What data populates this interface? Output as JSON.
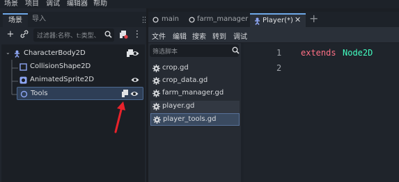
{
  "menu": [
    "场景",
    "项目",
    "调试",
    "编辑器",
    "帮助"
  ],
  "left_dock": {
    "tabs": [
      {
        "label": "场景",
        "active": true
      },
      {
        "label": "导入",
        "active": false
      }
    ],
    "filter_placeholder": "过滤器:名称、t:类型、",
    "tree": [
      {
        "label": "CharacterBody2D",
        "icon": "character-body-icon",
        "script": true,
        "visible": true
      },
      {
        "label": "CollisionShape2D",
        "icon": "collision-shape-icon",
        "script": false,
        "visible": false
      },
      {
        "label": "AnimatedSprite2D",
        "icon": "animated-sprite-icon",
        "script": false,
        "visible": true
      },
      {
        "label": "Tools",
        "icon": "node2d-icon",
        "script": true,
        "visible": true,
        "selected": true
      }
    ]
  },
  "doc_tabs": [
    {
      "label": "main",
      "active": false
    },
    {
      "label": "farm_manager",
      "active": false
    },
    {
      "label": "Player(*)",
      "active": true
    }
  ],
  "script_menu": [
    "文件",
    "编辑",
    "搜索",
    "转到",
    "调试"
  ],
  "file_panel": {
    "filter_placeholder": "筛选脚本",
    "files": [
      "crop.gd",
      "crop_data.gd",
      "farm_manager.gd",
      "player.gd",
      "player_tools.gd"
    ]
  },
  "editor": {
    "line_numbers": [
      "1",
      "2"
    ],
    "code_keyword": "extends",
    "code_class": "Node2D"
  },
  "colors": {
    "accent": "#6ea8e8",
    "keyword": "#ff7085",
    "class_name": "#42ffc2",
    "annotation_arrow": "#e8222b"
  }
}
